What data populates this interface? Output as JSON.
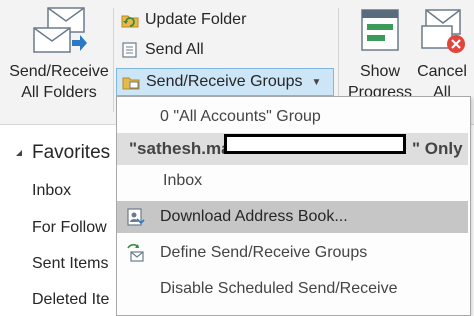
{
  "ribbon": {
    "send_receive_all": [
      "Send/Receive",
      "All Folders"
    ],
    "update_folder": "Update Folder",
    "send_all": "Send All",
    "send_receive_groups": "Send/Receive Groups",
    "show_progress": [
      "Show",
      "Progress"
    ],
    "cancel_all": [
      "Cancel",
      "All"
    ]
  },
  "left_pane": {
    "favorites": "Favorites",
    "folders": [
      "Inbox",
      "For Follow",
      "Sent Items",
      "Deleted Ite"
    ]
  },
  "menu": {
    "items": [
      {
        "text": "0 \"All Accounts\" Group"
      },
      {
        "text_prefix": "\"sathesh.ma",
        "text_suffix": "\" Only"
      },
      {
        "text": "Inbox"
      },
      {
        "text": "Download Address Book..."
      },
      {
        "text": "Define Send/Receive Groups"
      },
      {
        "text": "Disable Scheduled Send/Receive"
      }
    ]
  },
  "colors": {
    "ribbon_bg": "#f3f3f3",
    "active_button_bg": "#cde6f7",
    "menu_header_bg": "#dedede",
    "menu_hover_bg": "#c6c6c6",
    "cancel_badge": "#e0463c"
  },
  "icons": [
    "envelopes-icon",
    "update-folder-icon",
    "send-all-icon",
    "send-receive-groups-icon",
    "progress-icon",
    "cancel-icon",
    "address-book-icon",
    "define-groups-icon",
    "collapse-triangle-icon"
  ]
}
